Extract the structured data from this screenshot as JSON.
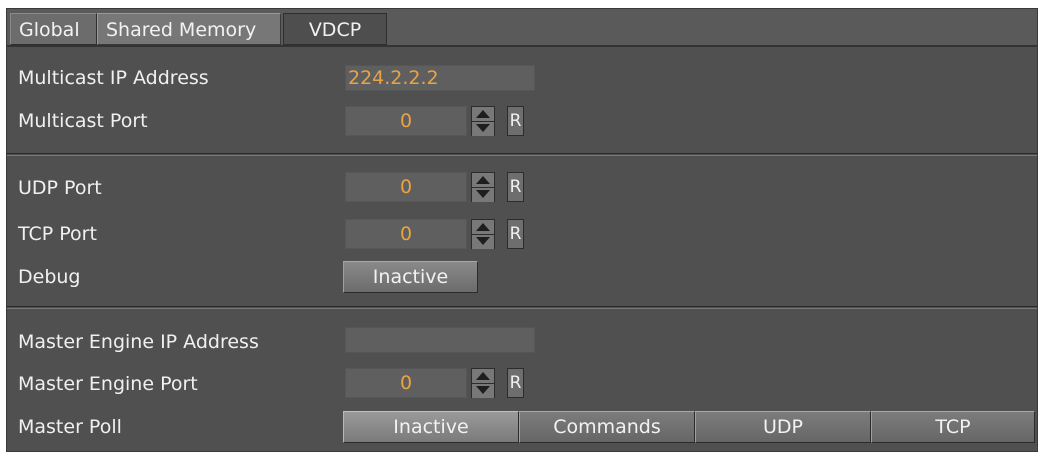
{
  "tabs": [
    {
      "label": "Global"
    },
    {
      "label": "Shared Memory"
    },
    {
      "label": "VDCP"
    }
  ],
  "multicast": {
    "ip_label": "Multicast IP Address",
    "ip_value": "224.2.2.2",
    "port_label": "Multicast Port",
    "port_value": "0"
  },
  "network": {
    "udp_label": "UDP Port",
    "udp_value": "0",
    "tcp_label": "TCP Port",
    "tcp_value": "0",
    "debug_label": "Debug",
    "debug_value": "Inactive"
  },
  "master": {
    "ip_label": "Master Engine IP Address",
    "ip_value": "",
    "port_label": "Master Engine Port",
    "port_value": "0",
    "poll_label": "Master Poll",
    "poll_options": [
      "Inactive",
      "Commands",
      "UDP",
      "TCP"
    ],
    "poll_selected": "Inactive"
  },
  "reset_label": "R",
  "colors": {
    "panel": "#505050",
    "value_text": "#e8a443",
    "label_text": "#f0f0f0"
  }
}
